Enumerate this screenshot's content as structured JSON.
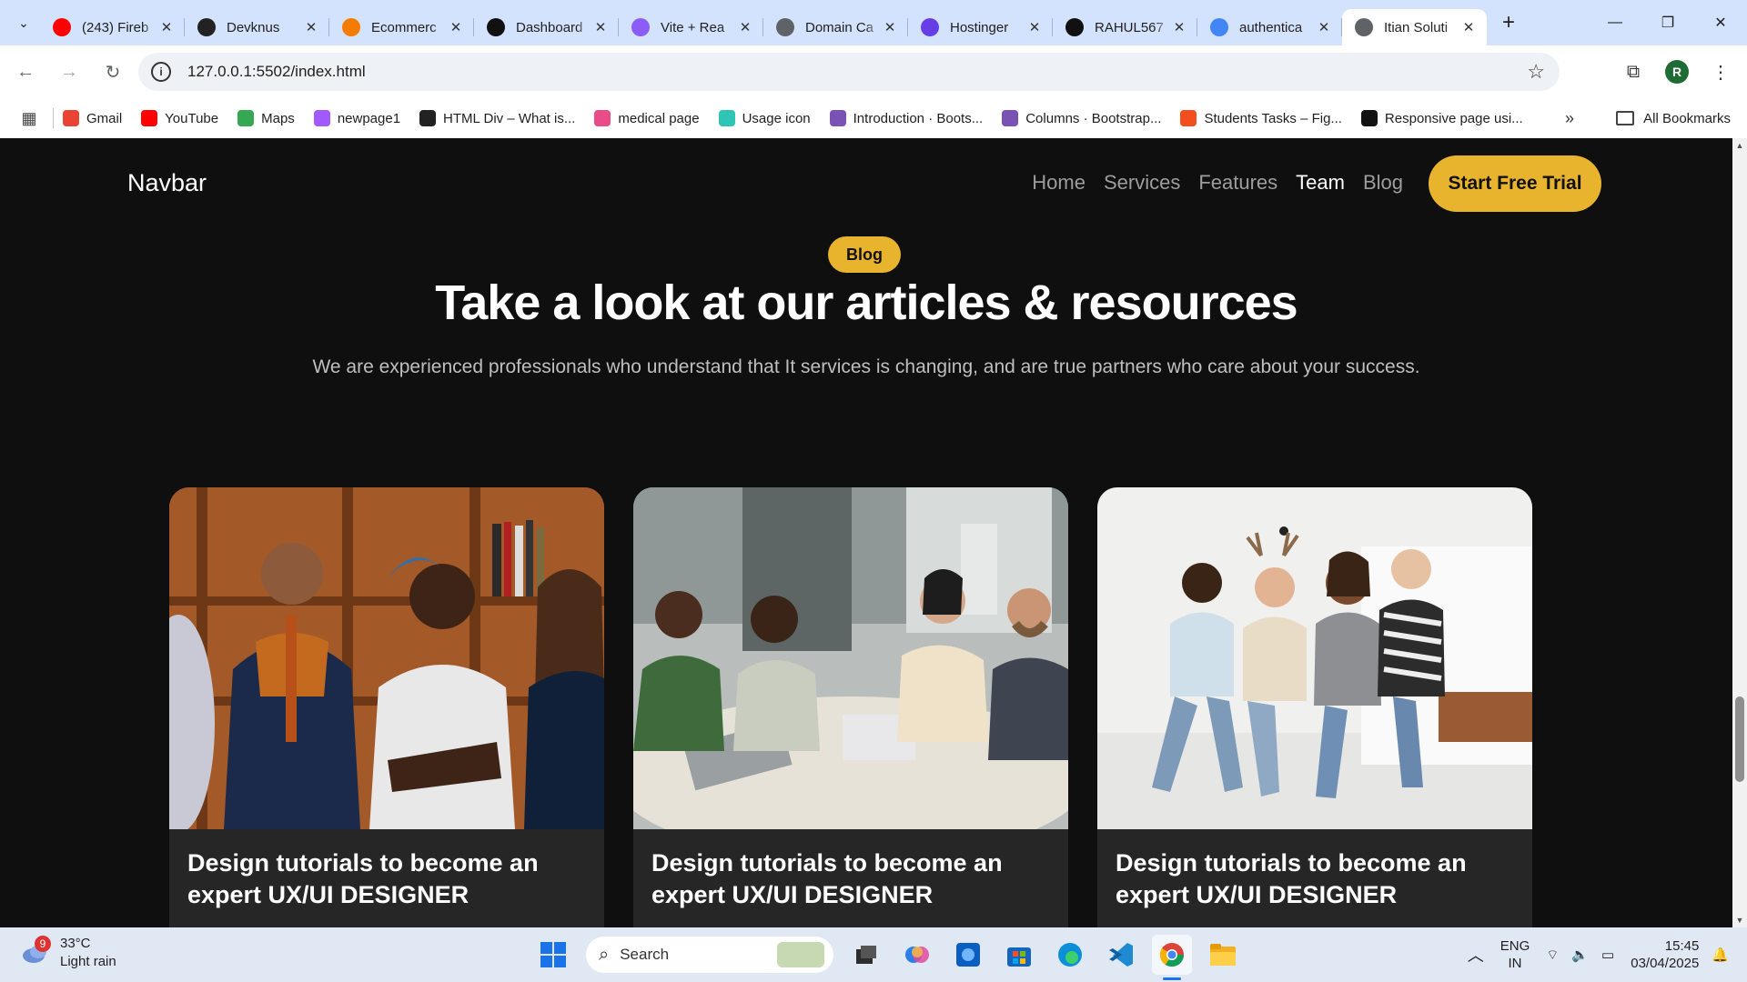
{
  "browser": {
    "tabs": [
      {
        "title": "(243) Fireb",
        "icon": "youtube-icon",
        "color": "#ff0000"
      },
      {
        "title": "Devknus",
        "icon": "globe-dark-icon",
        "color": "#222222"
      },
      {
        "title": "Ecommerc",
        "icon": "firebase-icon",
        "color": "#f57c00"
      },
      {
        "title": "Dashboard",
        "icon": "openai-icon",
        "color": "#111111"
      },
      {
        "title": "Vite + Rea",
        "icon": "vite-icon",
        "color": "#8b5cf6"
      },
      {
        "title": "Domain Ca",
        "icon": "globe-icon",
        "color": "#5f6368"
      },
      {
        "title": "Hostinger",
        "icon": "hostinger-icon",
        "color": "#673de6"
      },
      {
        "title": "RAHUL567",
        "icon": "github-icon",
        "color": "#111111"
      },
      {
        "title": "authentica",
        "icon": "google-icon",
        "color": "#4285f4"
      },
      {
        "title": "Itian Soluti",
        "icon": "globe-icon",
        "color": "#5f6368",
        "active": true
      }
    ],
    "url": "127.0.0.1:5502/index.html",
    "profile_initial": "R",
    "bookmarks": [
      {
        "label": "Gmail",
        "icon": "gmail-icon",
        "color": "#ea4335"
      },
      {
        "label": "YouTube",
        "icon": "youtube-icon",
        "color": "#ff0000"
      },
      {
        "label": "Maps",
        "icon": "maps-icon",
        "color": "#34a853"
      },
      {
        "label": "newpage1",
        "icon": "figma-icon",
        "color": "#a259ff"
      },
      {
        "label": "HTML Div – What is...",
        "icon": "angular-icon",
        "color": "#222222"
      },
      {
        "label": "medical page",
        "icon": "dribbble-icon",
        "color": "#ea4c89"
      },
      {
        "label": "Usage icon",
        "icon": "icons8-icon",
        "color": "#2ec4b6"
      },
      {
        "label": "Introduction · Boots...",
        "icon": "bootstrap-icon",
        "color": "#7952b3"
      },
      {
        "label": "Columns · Bootstrap...",
        "icon": "bootstrap-icon",
        "color": "#7952b3"
      },
      {
        "label": "Students Tasks – Fig...",
        "icon": "figma-icon",
        "color": "#f24e1e"
      },
      {
        "label": "Responsive page usi...",
        "icon": "github-icon",
        "color": "#111111"
      }
    ],
    "all_bookmarks": "All Bookmarks"
  },
  "site": {
    "brand": "Navbar",
    "nav": [
      "Home",
      "Services",
      "Features",
      "Team",
      "Blog"
    ],
    "nav_active": "Team",
    "cta": "Start Free Trial",
    "pill": "Blog",
    "heading": "Take a look at our articles & resources",
    "subheading": "We are experienced professionals who understand that It services is changing, and are true partners who care about your success.",
    "accent": "#e9b42d",
    "cards": [
      {
        "title": "Design tutorials to become an expert UX/UI DESIGNER",
        "image": "team-portrait-photo"
      },
      {
        "title": "Design tutorials to become an expert UX/UI DESIGNER",
        "image": "office-meeting-photo"
      },
      {
        "title": "Design tutorials to become an expert UX/UI DESIGNER",
        "image": "team-sitting-photo"
      }
    ]
  },
  "taskbar": {
    "weather_badge": "9",
    "temperature": "33°C",
    "condition": "Light rain",
    "search": "Search",
    "lang_line1": "ENG",
    "lang_line2": "IN",
    "time": "15:45",
    "date": "03/04/2025"
  }
}
